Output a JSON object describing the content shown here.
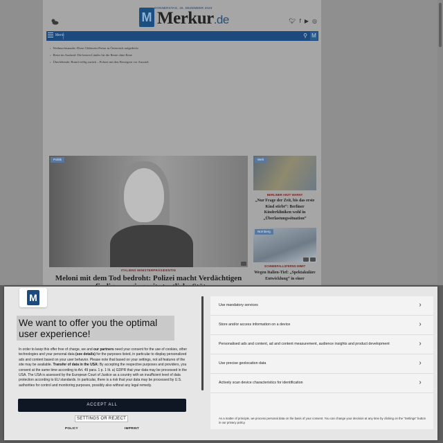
{
  "site": {
    "date": "DONNERSTAG, 26. DEZEMBER 2023",
    "logo_mark": "M",
    "logo_name": "Merkur",
    "logo_tld": ".de",
    "social_icons": [
      "twitter-icon",
      "facebook-icon",
      "youtube-icon",
      "instagram-icon"
    ]
  },
  "nav": {
    "menu_label": "Menü",
    "logo_mark": "M"
  },
  "headlines": [
    "Weihnachtsmarkt: Diese Glühwein-Preise in Österreich aufgedeckt",
    "Beste im Ausland: Die besten Länder für die Rente ohne Reue",
    "Überlebende: Brand völlig zurück – Polizei mit den Bewegern vor Ausstoß"
  ],
  "hero": {
    "tag": "Politik",
    "kicker": "ITALIENS MINISTERPRÄSIDENTIN",
    "title": "Meloni mit dem Tod bedroht: Polizei macht Verdächtigen ausfindig – er ging mit staatliche Stütze"
  },
  "side": [
    {
      "tag": "Welt",
      "kicker": "BERLINER ARZT WARNT",
      "title": "„Nur Frage der Zeit, bis das erste Kind stirbt“: Berliner Kinderkliniken wohl in „Überlastungssituation“"
    },
    {
      "tag": "Nürnberg",
      "kicker": "SCHNEEFALLSFERNS IMMIT",
      "title": "Wegen Italien-Tief: „Spektakuläre Entwicklung“ in einer"
    }
  ],
  "consent": {
    "logo_mark": "M",
    "title": "We want to offer you the optimal user experience!",
    "body_html_parts": [
      {
        "t": "In order to keep this offer free of charge, we and ",
        "b": false
      },
      {
        "t": "our partners",
        "b": true
      },
      {
        "t": " need your consent for the use of cookies, other technologies and your personal data ",
        "b": false
      },
      {
        "t": "(see details)",
        "b": true
      },
      {
        "t": " for the purposes listed, in particular to display personalized ads and content based on your user behavior. Please note that based on your settings, not all features of the site may be available. ",
        "b": false
      },
      {
        "t": "Transfer of data in the USA:",
        "b": true
      },
      {
        "t": " By accepting the respective purposes and providers, you consent at the same time according to Art. 49 para. 1 p. 1 lit. a) GDPR that your data may be processed in the USA. The USA is assessed by the European Court of Justice as a country with an insufficient level of data protection according to EU standards. In particular, there is a risk that your data may be processed by U.S. authorities for control and monitoring purposes, possibly also without any legal remedy.",
        "b": false
      }
    ],
    "accept_label": "ACCEPT ALL",
    "settings_label": "SETTINGS OR REJECT",
    "policy_label": "POLICY",
    "imprint_label": "IMPRINT",
    "purposes": [
      "Use mandatory services",
      "Store and/or access information on a device",
      "Personalised ads and content, ad and content measurement, audience insights and product development",
      "Use precise geolocation data",
      "Actively scan device characteristics for identification"
    ],
    "note": "As a matter of principle, we process personal data on the basis of your consent. You can change your decision at any time by clicking on the \"Settings\" button in our privacy policy.",
    "accent_color": "#0f1624",
    "brand_color": "#1c4a7e"
  }
}
